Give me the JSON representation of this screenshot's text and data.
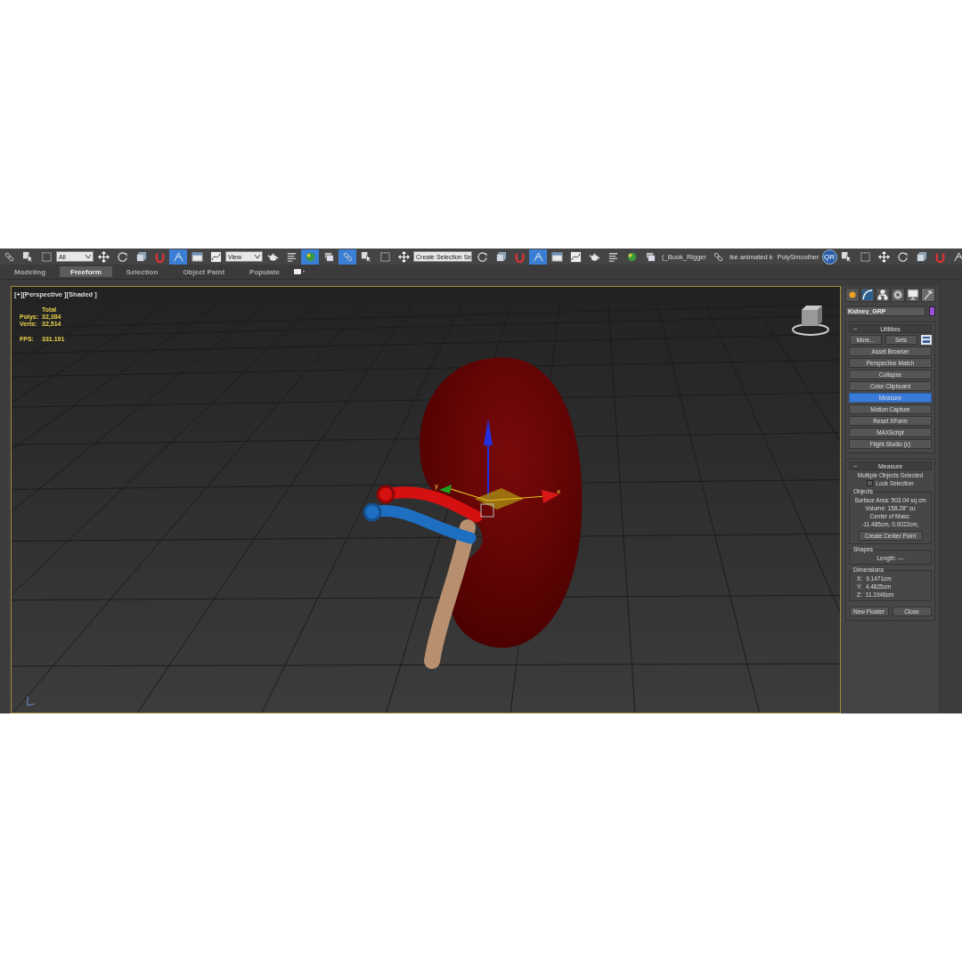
{
  "toolbar": {
    "items": [
      {
        "kind": "button",
        "active": false
      },
      {
        "kind": "button",
        "active": false
      },
      {
        "kind": "button",
        "active": false
      },
      {
        "kind": "dropdown",
        "value": "All"
      },
      {
        "kind": "button",
        "active": false
      },
      {
        "kind": "button",
        "active": false
      },
      {
        "kind": "button",
        "active": false
      },
      {
        "kind": "button",
        "active": false
      },
      {
        "kind": "button",
        "active": true
      },
      {
        "kind": "button",
        "active": false
      },
      {
        "kind": "button",
        "active": false
      },
      {
        "kind": "dropdown",
        "value": "View"
      },
      {
        "kind": "button",
        "active": false
      },
      {
        "kind": "button",
        "active": false
      },
      {
        "kind": "button",
        "active": true
      },
      {
        "kind": "button",
        "active": false
      },
      {
        "kind": "button",
        "active": true
      },
      {
        "kind": "button",
        "active": false
      },
      {
        "kind": "button",
        "active": false
      },
      {
        "kind": "button",
        "active": false
      },
      {
        "kind": "dropdown",
        "value": "Create Selection Se"
      },
      {
        "kind": "button",
        "active": false
      },
      {
        "kind": "button",
        "active": false
      },
      {
        "kind": "button",
        "active": false
      },
      {
        "kind": "button",
        "active": true
      },
      {
        "kind": "button",
        "active": false
      },
      {
        "kind": "button",
        "active": false
      },
      {
        "kind": "button",
        "active": false
      },
      {
        "kind": "button",
        "active": false
      },
      {
        "kind": "button",
        "active": false
      },
      {
        "kind": "button",
        "active": false
      },
      {
        "kind": "text",
        "label": "(_Book_Rigger"
      },
      {
        "kind": "button",
        "active": false
      },
      {
        "kind": "text",
        "label": "ike animated k"
      },
      {
        "kind": "text",
        "label": "PolySmoother"
      },
      {
        "kind": "qr",
        "label": "QR"
      },
      {
        "kind": "button",
        "active": false
      },
      {
        "kind": "button",
        "active": false
      },
      {
        "kind": "button",
        "active": false
      },
      {
        "kind": "button",
        "active": false
      },
      {
        "kind": "button",
        "active": false
      },
      {
        "kind": "button",
        "active": false
      },
      {
        "kind": "button",
        "active": false
      }
    ]
  },
  "ribbon": {
    "tabs": [
      {
        "label": "Modeling",
        "selected": false
      },
      {
        "label": "Freeform",
        "selected": true
      },
      {
        "label": "Selection",
        "selected": false
      },
      {
        "label": "Object Paint",
        "selected": false
      },
      {
        "label": "Populate",
        "selected": false
      }
    ]
  },
  "viewport": {
    "label": "[+][Perspective ][Shaded ]",
    "stats": {
      "header": "Total",
      "rows": [
        {
          "label": "Polys:",
          "value": "32,384"
        },
        {
          "label": "Verts:",
          "value": "32,514"
        }
      ],
      "fps_label": "FPS:",
      "fps_value": "331.191"
    },
    "gizmo": {
      "x_label": "x",
      "y_label": "y"
    }
  },
  "command_panel": {
    "tabs": [
      {
        "selected": false
      },
      {
        "selected": false
      },
      {
        "selected": false
      },
      {
        "selected": false
      },
      {
        "selected": false
      },
      {
        "selected": true
      }
    ],
    "object_name": "Kidney_GRP",
    "utilities": {
      "collapse_sign": "−",
      "title": "Utilities",
      "more": "More...",
      "sets": "Sets",
      "buttons": [
        {
          "label": "Asset Browser",
          "selected": false
        },
        {
          "label": "Perspective Match",
          "selected": false
        },
        {
          "label": "Collapse",
          "selected": false
        },
        {
          "label": "Color Clipboard",
          "selected": false
        },
        {
          "label": "Measure",
          "selected": true
        },
        {
          "label": "Motion Capture",
          "selected": false
        },
        {
          "label": "Reset XForm",
          "selected": false
        },
        {
          "label": "MAXScript",
          "selected": false
        },
        {
          "label": "Flight Studio (c)",
          "selected": false
        }
      ]
    },
    "measure": {
      "collapse_sign": "−",
      "title": "Measure",
      "status": "Multiple Objects Selected",
      "lock_selection": {
        "label": "Lock Selection",
        "checked": false
      },
      "objects": {
        "title": "Objects",
        "lines": [
          "Surface Area: 503.04 sq cm",
          "Volume: 158.28\" cu",
          "Center of Mass:",
          "-11.485cm, 0.0022cm,"
        ],
        "button": "Create Center Point"
      },
      "shapes": {
        "title": "Shapes",
        "line": "Length: ---"
      },
      "dimensions": {
        "title": "Dimensions",
        "rows": [
          {
            "axis": "X:",
            "value": "9.1471cm"
          },
          {
            "axis": "Y:",
            "value": "4.4825cm"
          },
          {
            "axis": "Z:",
            "value": "11.1946cm"
          }
        ]
      },
      "buttons": [
        "New Floater",
        "Close"
      ]
    }
  }
}
